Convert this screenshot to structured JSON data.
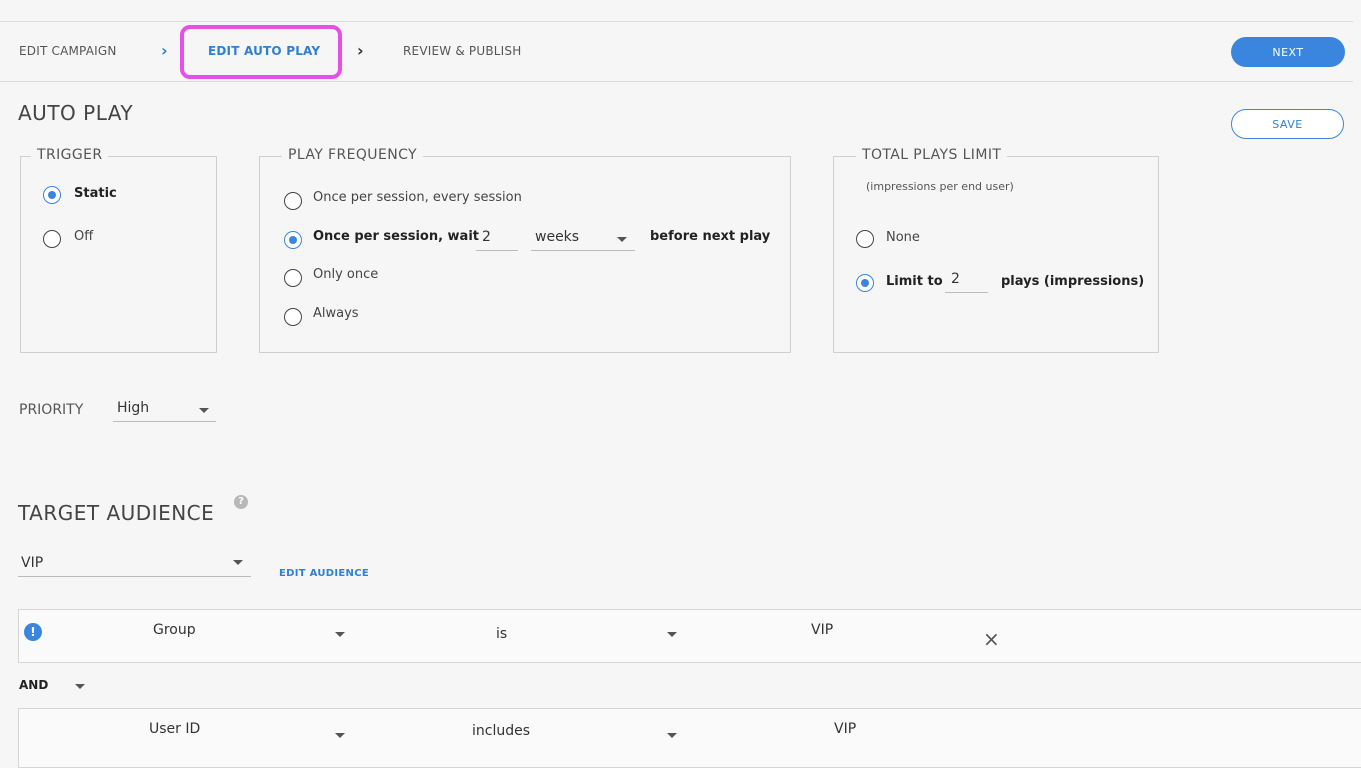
{
  "steps": {
    "edit_campaign": "EDIT CAMPAIGN",
    "edit_auto_play": "EDIT AUTO PLAY",
    "review_publish": "REVIEW & PUBLISH",
    "chevron": "›"
  },
  "buttons": {
    "next": "NEXT",
    "save": "SAVE"
  },
  "auto_play": {
    "title": "AUTO PLAY",
    "trigger": {
      "legend": "TRIGGER",
      "options": [
        {
          "label": "Static",
          "selected": true
        },
        {
          "label": "Off",
          "selected": false
        }
      ]
    },
    "frequency": {
      "legend": "PLAY FREQUENCY",
      "options": [
        {
          "label": "Once per session, every session",
          "selected": false
        },
        {
          "label": "Once per session, wait",
          "selected": true
        },
        {
          "label": "Only once",
          "selected": false
        },
        {
          "label": "Always",
          "selected": false
        }
      ],
      "wait_value": "2",
      "wait_unit": "weeks",
      "suffix": "before next play"
    },
    "limit": {
      "legend": "TOTAL PLAYS LIMIT",
      "note": "(impressions per end user)",
      "options": [
        {
          "label": "None",
          "selected": false
        },
        {
          "label": "Limit to",
          "selected": true
        }
      ],
      "limit_value": "2",
      "suffix": "plays (impressions)"
    },
    "priority": {
      "label": "PRIORITY",
      "value": "High"
    }
  },
  "audience": {
    "title": "TARGET AUDIENCE",
    "help_glyph": "?",
    "selected": "VIP",
    "edit_link": "EDIT AUDIENCE",
    "alert_glyph": "!",
    "close_glyph": "×",
    "rules": [
      {
        "field": "Group",
        "operator": "is",
        "value": "VIP"
      },
      {
        "field": "User ID",
        "operator": "includes",
        "value": "VIP"
      }
    ],
    "conjunction": "AND"
  },
  "colors": {
    "accent": "#3a86de",
    "highlight": "#e84ee8",
    "background": "#f6f6f6"
  }
}
